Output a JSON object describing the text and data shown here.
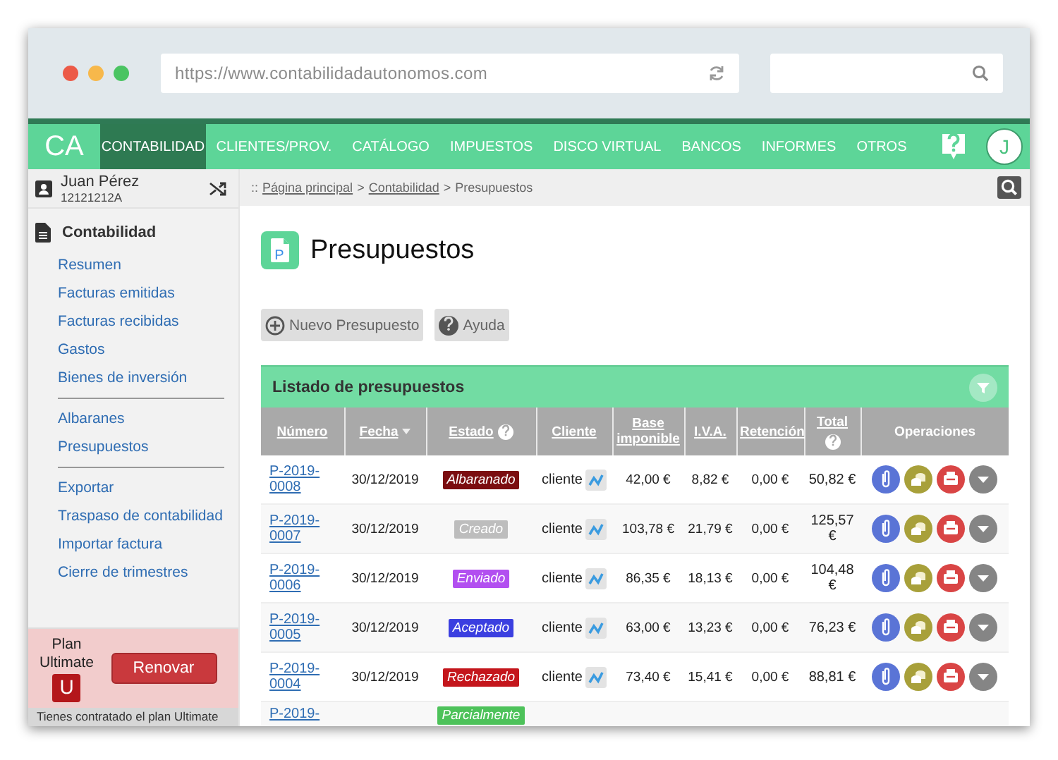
{
  "browser": {
    "url": "https://www.contabilidadautonomos.com"
  },
  "nav": {
    "logo": "CA",
    "avatar": "J",
    "items": [
      {
        "label": "CONTABILIDAD",
        "selected": true
      },
      {
        "label": "CLIENTES/PROV.",
        "selected": false
      },
      {
        "label": "CATÁLOGO",
        "selected": false
      },
      {
        "label": "IMPUESTOS",
        "selected": false
      },
      {
        "label": "DISCO VIRTUAL",
        "selected": false
      },
      {
        "label": "BANCOS",
        "selected": false
      },
      {
        "label": "INFORMES",
        "selected": false
      },
      {
        "label": "OTROS",
        "selected": false
      }
    ]
  },
  "user": {
    "name": "Juan Pérez",
    "id": "12121212A"
  },
  "sidebar": {
    "section": "Contabilidad",
    "groups": [
      [
        "Resumen",
        "Facturas emitidas",
        "Facturas recibidas",
        "Gastos",
        "Bienes de inversión"
      ],
      [
        "Albaranes",
        "Presupuestos"
      ],
      [
        "Exportar",
        "Traspaso de contabilidad",
        "Importar factura",
        "Cierre de trimestres"
      ]
    ]
  },
  "plan": {
    "label": "Plan",
    "name": "Ultimate",
    "badge": "U",
    "button": "Renovar",
    "notice": "Tienes contratado el plan Ultimate"
  },
  "breadcrumb": {
    "prefix": "::",
    "separator": ">",
    "items": [
      {
        "label": "Página principal",
        "link": true
      },
      {
        "label": "Contabilidad",
        "link": true
      },
      {
        "label": "Presupuestos",
        "link": false
      }
    ]
  },
  "page": {
    "title": "Presupuestos",
    "icon_letter": "P",
    "buttons": [
      {
        "kind": "add",
        "label": "Nuevo Presupuesto"
      },
      {
        "kind": "help",
        "label": "Ayuda"
      }
    ]
  },
  "listing": {
    "title": "Listado de presupuestos",
    "columns": [
      {
        "label": "Número",
        "kind": "plain"
      },
      {
        "label": "Fecha",
        "kind": "sort"
      },
      {
        "label": "Estado",
        "kind": "help"
      },
      {
        "label": "Cliente",
        "kind": "plain"
      },
      {
        "label": "Base imponible",
        "kind": "plain"
      },
      {
        "label": "I.V.A.",
        "kind": "plain"
      },
      {
        "label": "Retención",
        "kind": "plain"
      },
      {
        "label": "Total",
        "kind": "help"
      },
      {
        "label": "Operaciones",
        "kind": "static"
      }
    ],
    "rows": [
      {
        "numero": "P-2019-0008",
        "fecha": "30/12/2019",
        "estado": "Albaranado",
        "color": "#7b0d10",
        "cliente": "cliente",
        "base": "42,00 €",
        "iva": "8,82 €",
        "retencion": "0,00 €",
        "total": "50,82 €"
      },
      {
        "numero": "P-2019-0007",
        "fecha": "30/12/2019",
        "estado": "Creado",
        "color": "#bdbdbd",
        "cliente": "cliente",
        "base": "103,78 €",
        "iva": "21,79 €",
        "retencion": "0,00 €",
        "total": "125,57 €"
      },
      {
        "numero": "P-2019-0006",
        "fecha": "30/12/2019",
        "estado": "Enviado",
        "color": "#b24ff0",
        "cliente": "cliente",
        "base": "86,35 €",
        "iva": "18,13 €",
        "retencion": "0,00 €",
        "total": "104,48 €"
      },
      {
        "numero": "P-2019-0005",
        "fecha": "30/12/2019",
        "estado": "Aceptado",
        "color": "#3b3fe0",
        "cliente": "cliente",
        "base": "63,00 €",
        "iva": "13,23 €",
        "retencion": "0,00 €",
        "total": "76,23 €"
      },
      {
        "numero": "P-2019-0004",
        "fecha": "30/12/2019",
        "estado": "Rechazado",
        "color": "#c4161c",
        "cliente": "cliente",
        "base": "73,40 €",
        "iva": "15,41 €",
        "retencion": "0,00 €",
        "total": "88,81 €"
      },
      {
        "numero": "P-2019-",
        "estado": "Parcialmente",
        "color": "#4dc25a",
        "partial": true
      }
    ]
  }
}
